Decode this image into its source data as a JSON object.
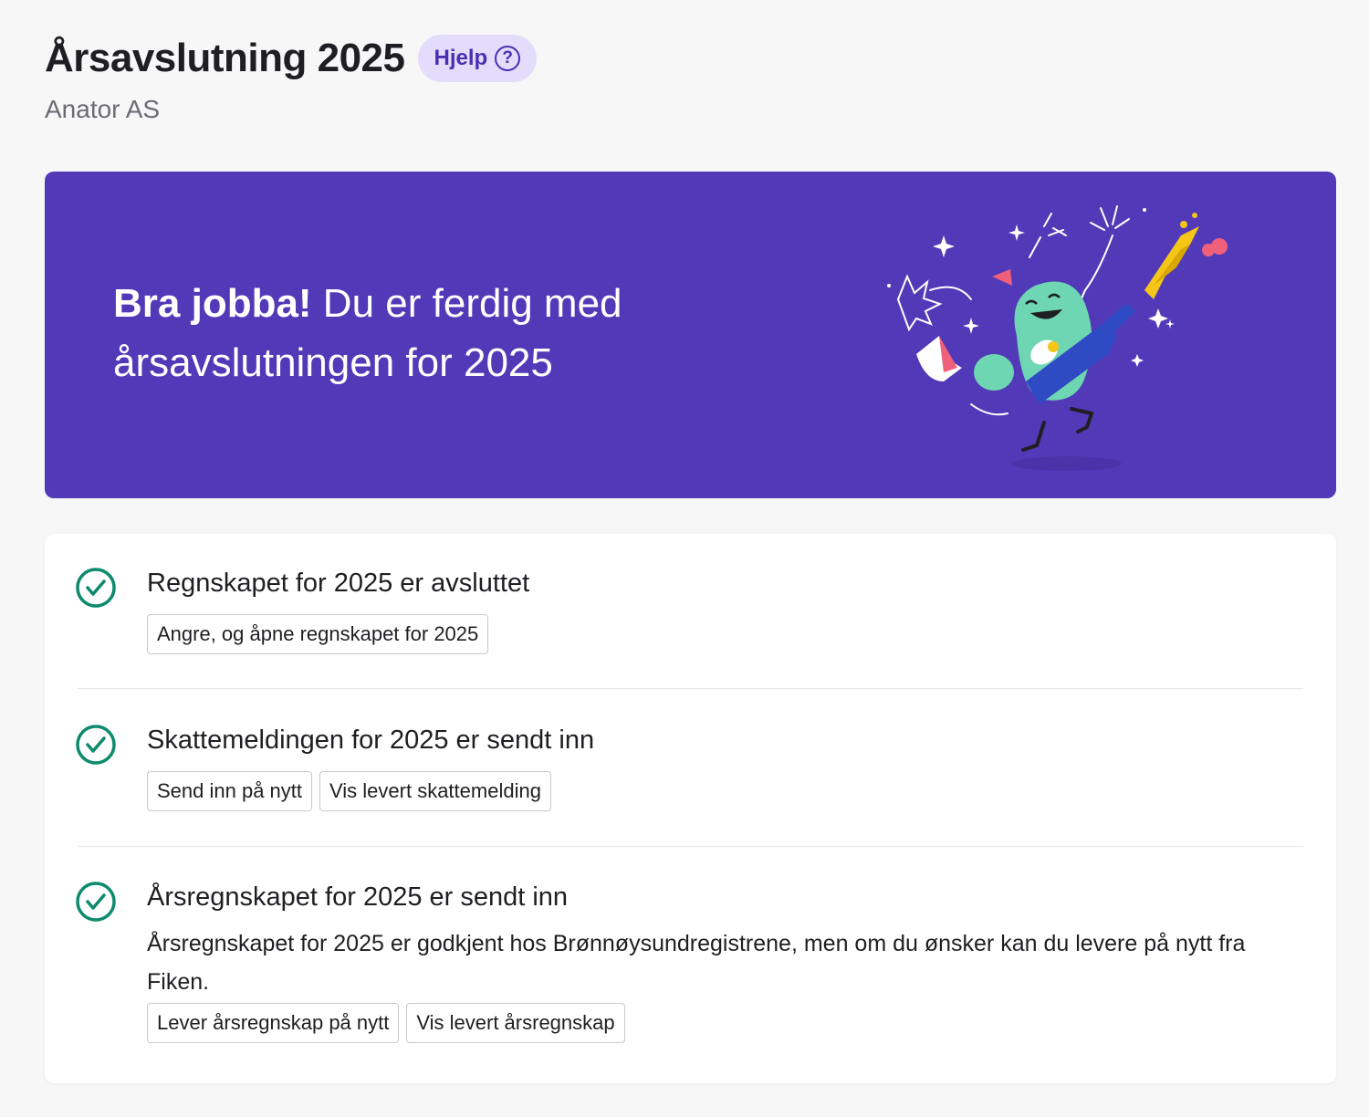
{
  "header": {
    "title": "Årsavslutning 2025",
    "help_label": "Hjelp",
    "help_icon": "question-circle-icon",
    "company": "Anator AS"
  },
  "banner": {
    "headline_bold": "Bra jobba!",
    "headline_rest": " Du er ferdig med årsavslutningen for 2025",
    "background": "#5139b8"
  },
  "steps": [
    {
      "title": "Regnskapet for 2025 er avsluttet",
      "status_icon": "check-circle-icon",
      "buttons": [
        "Angre, og åpne regnskapet for 2025"
      ]
    },
    {
      "title": "Skattemeldingen for 2025 er sendt inn",
      "status_icon": "check-circle-icon",
      "buttons": [
        "Send inn på nytt",
        "Vis levert skattemelding"
      ]
    },
    {
      "title": "Årsregnskapet for 2025 er sendt inn",
      "status_icon": "check-circle-icon",
      "description": "Årsregnskapet for 2025 er godkjent hos Brønnøysundregistrene, men om du ønsker kan du levere på nytt fra Fiken.",
      "buttons": [
        "Lever årsregnskap på nytt",
        "Vis levert årsregnskap"
      ]
    }
  ],
  "colors": {
    "accent": "#5139b8",
    "success": "#0e8a6c",
    "help_bg": "#e3dcfb"
  }
}
